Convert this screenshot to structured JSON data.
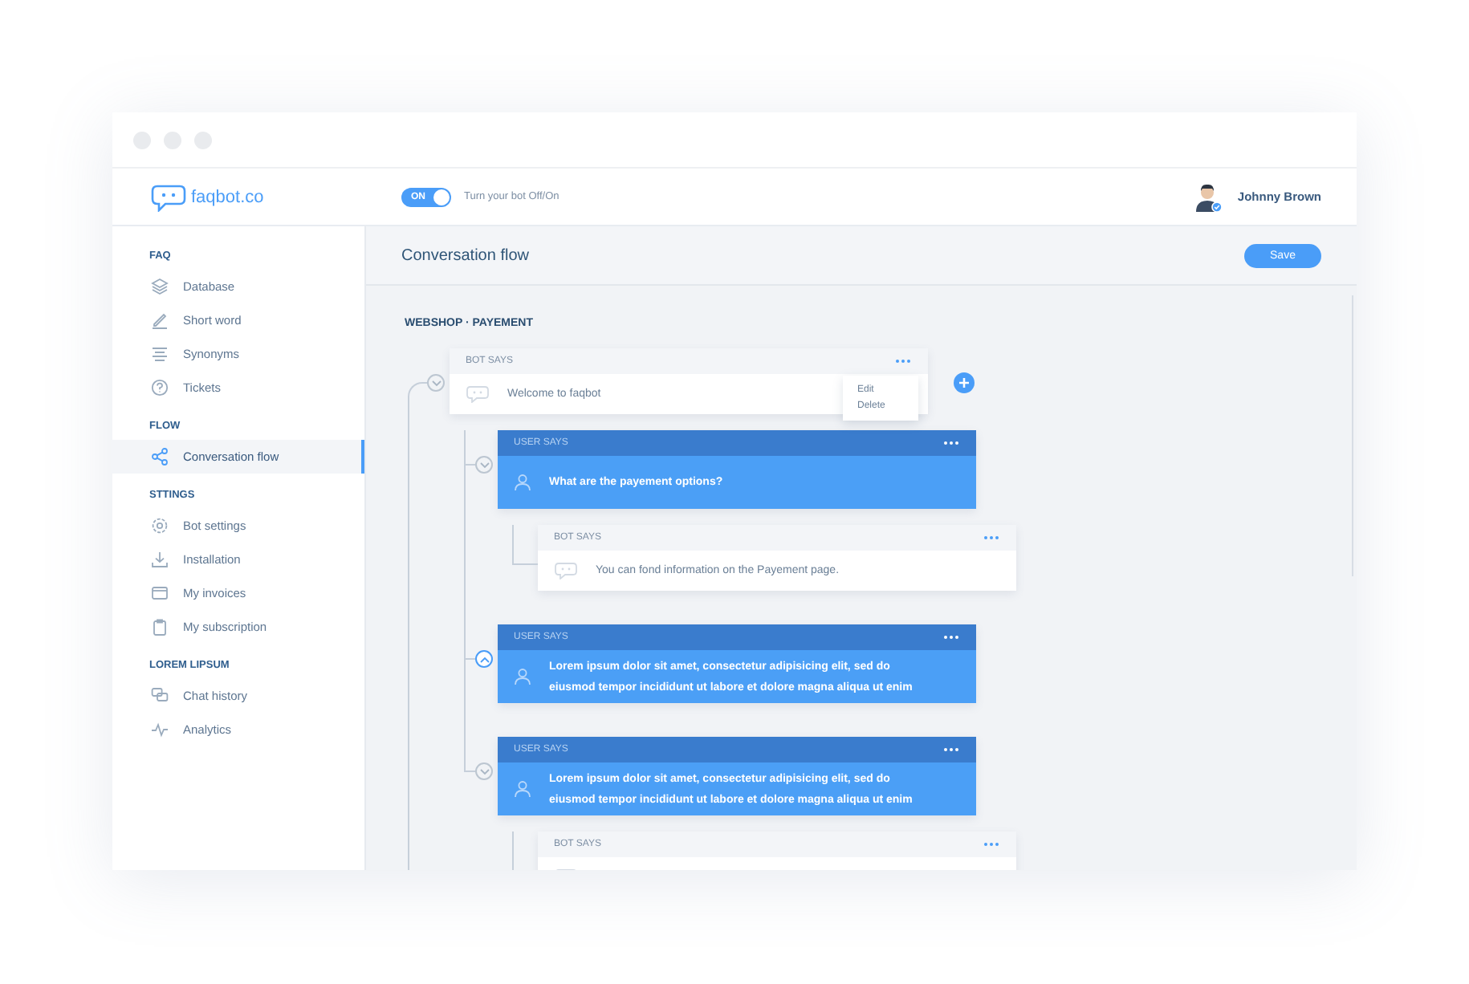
{
  "header": {
    "logo": "faqbot.co",
    "bot_switch": {
      "label": "ON",
      "on": true
    },
    "switch_caption": "Turn your bot Off/On",
    "user": {
      "name": "Johnny Brown"
    }
  },
  "sidebar": {
    "sections": [
      {
        "title": "FAQ",
        "items": [
          {
            "label": "Database",
            "selected": false
          },
          {
            "label": "Short word",
            "selected": false
          },
          {
            "label": "Synonyms",
            "selected": false
          },
          {
            "label": "Tickets",
            "selected": false
          }
        ]
      },
      {
        "title": "FLOW",
        "items": [
          {
            "label": "Conversation flow",
            "selected": true
          }
        ]
      },
      {
        "title": "STTINGS",
        "items": [
          {
            "label": "Bot settings",
            "selected": false
          },
          {
            "label": "Installation",
            "selected": false
          },
          {
            "label": "My invoices",
            "selected": false
          },
          {
            "label": "My subscription",
            "selected": false
          }
        ]
      },
      {
        "title": "LOREM LIPSUM",
        "items": [
          {
            "label": "Chat history",
            "selected": false
          },
          {
            "label": "Analytics",
            "selected": false
          }
        ]
      }
    ]
  },
  "page": {
    "title": "Conversation flow",
    "save_button": "Save"
  },
  "flow": {
    "title": "WEBSHOP · PAYEMENT",
    "nodes": [
      {
        "kind": "bot",
        "label": "BOT SAYS",
        "text": "Welcome to faqbot",
        "active": false,
        "menu": [
          "Edit",
          "Delete"
        ],
        "children": [
          {
            "kind": "user",
            "label": "USER SAYS",
            "text": "What are the payement options?",
            "active": false,
            "children": [
              {
                "kind": "bot",
                "label": "BOT SAYS",
                "text": "You can fond information on the Payement page."
              }
            ]
          },
          {
            "kind": "user",
            "label": "USER SAYS",
            "text": "Lorem ipsum dolor sit amet, consectetur adipisicing elit, sed do eiusmod tempor incididunt ut labore et dolore magna aliqua ut enim",
            "active": true
          },
          {
            "kind": "user",
            "label": "USER SAYS",
            "text": "Lorem ipsum dolor sit amet, consectetur adipisicing elit, sed do eiusmod tempor incididunt ut labore et dolore magna aliqua ut enim",
            "active": false,
            "children": [
              {
                "kind": "bot",
                "label": "BOT SAYS"
              }
            ]
          }
        ]
      }
    ]
  }
}
